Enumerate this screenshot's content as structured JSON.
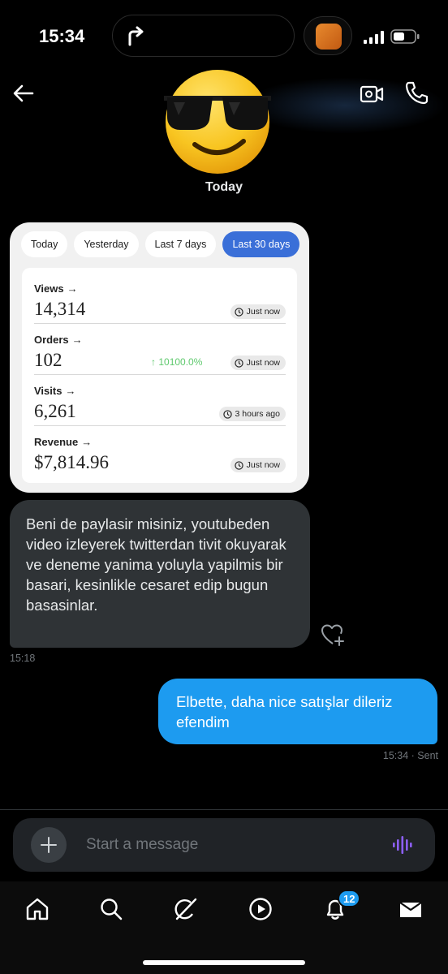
{
  "status_bar": {
    "time": "15:34"
  },
  "header": {
    "date_label": "Today"
  },
  "stats_card": {
    "tabs": [
      {
        "label": "Today"
      },
      {
        "label": "Yesterday"
      },
      {
        "label": "Last 7 days"
      },
      {
        "label": "Last 30 days"
      }
    ],
    "active_tab": "Last 30 days",
    "rows": [
      {
        "label": "Views",
        "value": "14,314",
        "updated": "Just now",
        "change": ""
      },
      {
        "label": "Orders",
        "value": "102",
        "updated": "Just now",
        "change": "10100.0%"
      },
      {
        "label": "Visits",
        "value": "6,261",
        "updated": "3 hours ago",
        "change": ""
      },
      {
        "label": "Revenue",
        "value": "$7,814.96",
        "updated": "Just now",
        "change": ""
      }
    ]
  },
  "messages": {
    "incoming": {
      "text": "Beni de paylasir misiniz, youtubeden video izleyerek twitterdan tivit okuyarak ve deneme yanima yoluyla yapilmis bir basari, kesinlikle cesaret edip bugun basasinlar.",
      "time": "15:18"
    },
    "outgoing": {
      "text": "Elbette, daha nice satışlar dileriz efendim",
      "meta": "15:34 · Sent"
    }
  },
  "composer": {
    "placeholder": "Start a message"
  },
  "bottom_nav": {
    "items": [
      "home-icon",
      "search-icon",
      "grok-icon",
      "video-icon",
      "notifications-icon",
      "messages-icon"
    ],
    "notifications_badge": "12"
  },
  "colors": {
    "accent": "#1d9bf0",
    "tab_active": "#3a6fd8",
    "positive": "#5ec96d",
    "incoming_bubble": "#2f3336"
  }
}
